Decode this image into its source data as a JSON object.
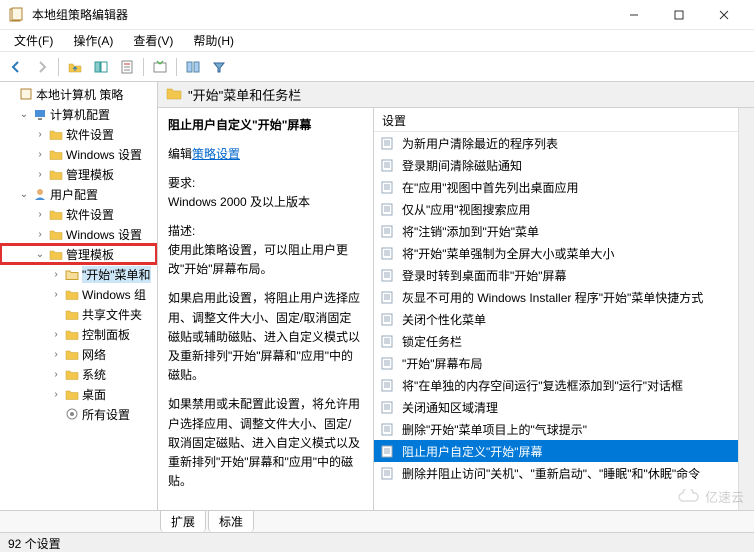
{
  "window": {
    "title": "本地组策略编辑器"
  },
  "menu": {
    "file": "文件(F)",
    "action": "操作(A)",
    "view": "查看(V)",
    "help": "帮助(H)"
  },
  "tree": {
    "root": "本地计算机 策略",
    "computer_config": "计算机配置",
    "cc_software": "软件设置",
    "cc_windows": "Windows 设置",
    "cc_admin": "管理模板",
    "user_config": "用户配置",
    "uc_software": "软件设置",
    "uc_windows": "Windows 设置",
    "uc_admin": "管理模板",
    "start_taskbar": "\"开始\"菜单和",
    "windows_comp": "Windows 组",
    "shared_folders": "共享文件夹",
    "control_panel": "控制面板",
    "network": "网络",
    "system": "系统",
    "desktop": "桌面",
    "all_settings": "所有设置"
  },
  "location": "\"开始\"菜单和任务栏",
  "description": {
    "title": "阻止用户自定义\"开始\"屏幕",
    "edit_prefix": "编辑",
    "edit_link": "策略设置",
    "req_label": "要求:",
    "req_text": "Windows 2000 及以上版本",
    "desc_label": "描述:",
    "para1": "使用此策略设置，可以阻止用户更改\"开始\"屏幕布局。",
    "para2": "如果启用此设置，将阻止用户选择应用、调整文件大小、固定/取消固定磁贴或辅助磁贴、进入自定义模式以及重新排列\"开始\"屏幕和\"应用\"中的磁贴。",
    "para3": "如果禁用或未配置此设置，将允许用户选择应用、调整文件大小、固定/取消固定磁贴、进入自定义模式以及重新排列\"开始\"屏幕和\"应用\"中的磁贴。"
  },
  "settings_header": "设置",
  "settings": [
    "为新用户清除最近的程序列表",
    "登录期间清除磁贴通知",
    "在\"应用\"视图中首先列出桌面应用",
    "仅从\"应用\"视图搜索应用",
    "将\"注销\"添加到\"开始\"菜单",
    "将\"开始\"菜单强制为全屏大小或菜单大小",
    "登录时转到桌面而非\"开始\"屏幕",
    "灰显不可用的 Windows Installer 程序\"开始\"菜单快捷方式",
    "关闭个性化菜单",
    "锁定任务栏",
    "\"开始\"屏幕布局",
    "将\"在单独的内存空间运行\"复选框添加到\"运行\"对话框",
    "关闭通知区域清理",
    "删除\"开始\"菜单项目上的\"气球提示\"",
    "阻止用户自定义\"开始\"屏幕",
    "删除并阻止访问\"关机\"、\"重新启动\"、\"睡眠\"和\"休眠\"命令"
  ],
  "selected_setting_index": 14,
  "tabs": {
    "extended": "扩展",
    "standard": "标准"
  },
  "statusbar": "92 个设置",
  "watermark": "亿速云"
}
